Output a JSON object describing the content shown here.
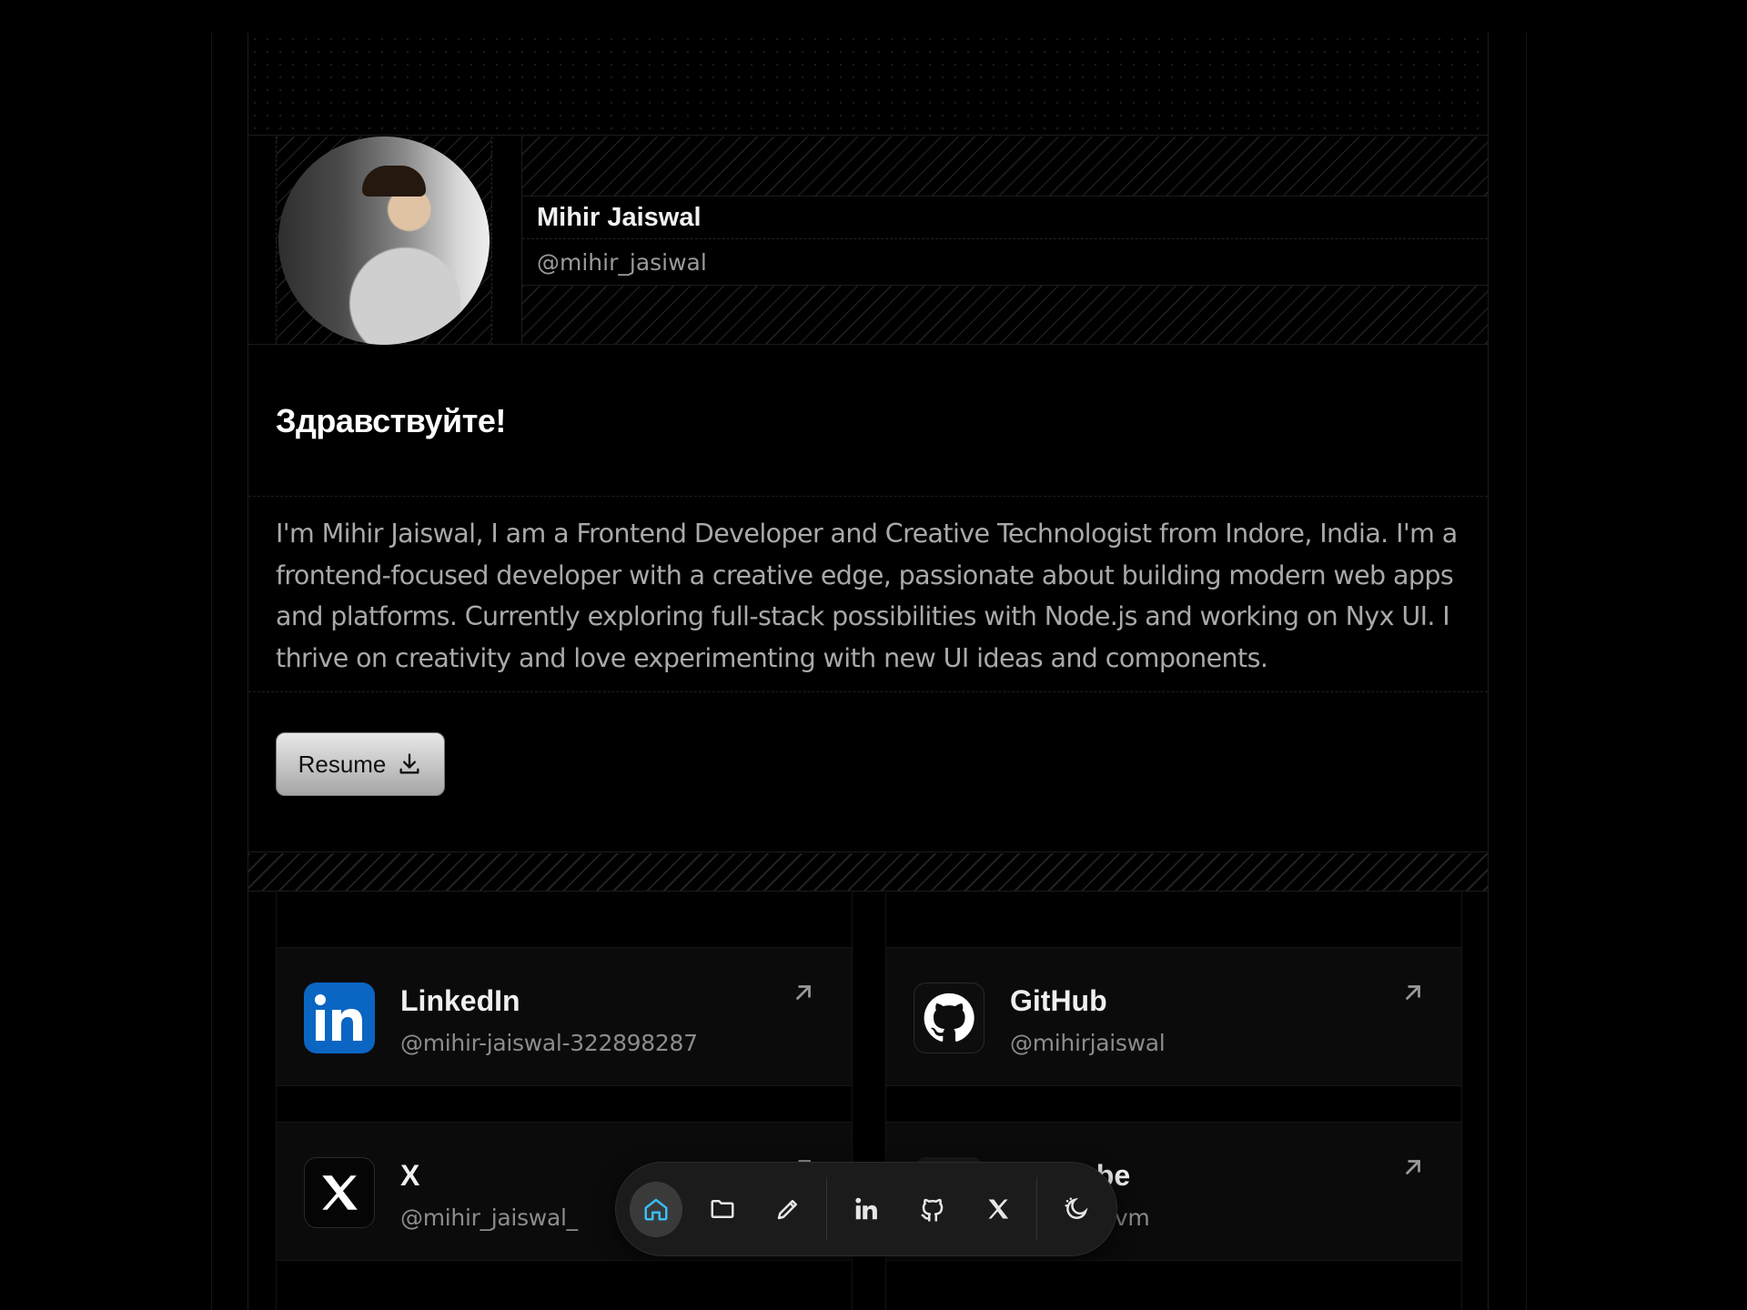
{
  "profile": {
    "name": "Mihir Jaiswal",
    "handle": "@mihir_jasiwal",
    "greeting": "Здравствуйте!",
    "bio": "I'm Mihir Jaiswal, I am a Frontend Developer and Creative Technologist from Indore, India. I'm a frontend-focused developer with a creative edge, passionate about building modern web apps and platforms. Currently exploring full-stack possibilities with Node.js and working on Nyx UI. I thrive on creativity and love experimenting with new UI ideas and components.",
    "resume_label": "Resume"
  },
  "socials": [
    {
      "title": "LinkedIn",
      "handle": "@mihir-jaiswal-322898287",
      "icon": "linkedin-icon",
      "color": "#0a66c2"
    },
    {
      "title": "GitHub",
      "handle": "@mihirjaiswal",
      "icon": "github-icon",
      "color": "#ffffff"
    },
    {
      "title": "X",
      "handle": "@mihir_jaiswal_",
      "icon": "x-icon",
      "color": "#000000"
    },
    {
      "title": "YouTube",
      "handle": "iswal-vn4vm",
      "icon": "youtube-icon",
      "color": "#ff0033"
    }
  ],
  "dock": {
    "items": [
      "home-icon",
      "folder-icon",
      "pencil-icon",
      "linkedin-icon",
      "github-icon",
      "x-icon",
      "theme-toggle-icon"
    ],
    "active": "home-icon",
    "accent": "#38bdf8"
  }
}
